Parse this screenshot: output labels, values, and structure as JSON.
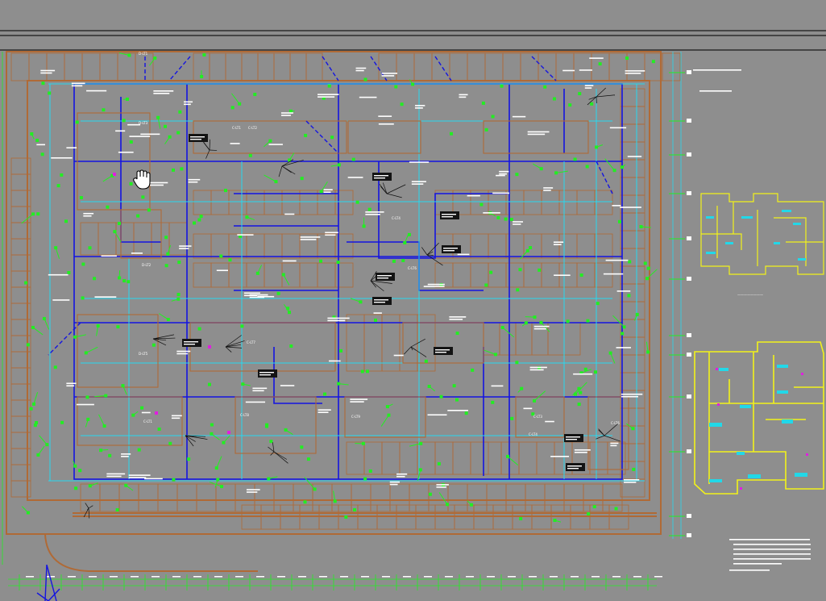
{
  "drawing": {
    "background_color": "#8e8e8e",
    "colors": {
      "wall": "#b06a36",
      "wire_blue": "#1414e0",
      "wire_cyan": "#27d8f0",
      "device_green": "#22ee22",
      "minimap_yellow": "#f2f21a",
      "room_cyan": "#22d8e8",
      "text_white": "#ffffff",
      "frame_line": "#1a1a1a"
    }
  },
  "labels": {
    "lt_1": "C-LT1",
    "lt_2": "C-LT2",
    "lt_3": "D-LT3",
    "lt_4": "C-LT4",
    "lt_5": "D-LT5",
    "lt_6": "C-LT6",
    "lt_7": "C-LT7",
    "lt_8": "C-LT8",
    "lt_9": "C-LT9",
    "lt_10": "D-LT2",
    "lt_11": "C-LT3",
    "lt_12": "D-LT1"
  },
  "cursor": {
    "icon": "hand-cursor-icon"
  }
}
